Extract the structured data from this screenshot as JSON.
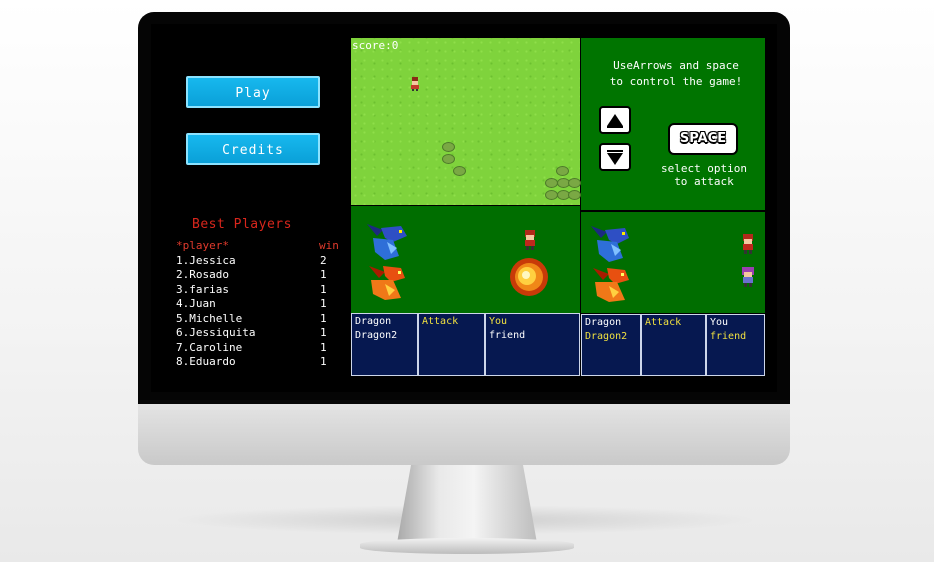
{
  "menu": {
    "play_label": "Play",
    "credits_label": "Credits"
  },
  "leaderboard": {
    "title": "Best Players",
    "header_player": "*player*",
    "header_win": "win",
    "rows": [
      {
        "name": "1.Jessica",
        "win": "2"
      },
      {
        "name": "2.Rosado",
        "win": "1"
      },
      {
        "name": "3.farias",
        "win": "1"
      },
      {
        "name": "4.Juan",
        "win": "1"
      },
      {
        "name": "5.Michelle",
        "win": "1"
      },
      {
        "name": "6.Jessiquita",
        "win": "1"
      },
      {
        "name": "7.Caroline",
        "win": "1"
      },
      {
        "name": "8.Eduardo",
        "win": "1"
      }
    ]
  },
  "game": {
    "score": "score:0",
    "instructions_line1": "UseArrows and space",
    "instructions_line2": "to control the game!",
    "space_key": "SPACE",
    "select_line1": "select option",
    "select_line2": "to attack"
  },
  "battle1": {
    "enemies": [
      "Dragon",
      "Dragon2"
    ],
    "action": "Attack",
    "party": [
      "You",
      "friend"
    ]
  },
  "battle2": {
    "enemies": [
      "Dragon",
      "Dragon2"
    ],
    "action": "Attack",
    "party": [
      "You",
      "friend"
    ]
  },
  "colors": {
    "map_grass": "#7fd33c",
    "panel_green": "#006e00",
    "menu_box": "#061850",
    "button": "#0aa0d8",
    "leaderboard_title": "#d8261c",
    "highlight_text": "#f0e040"
  }
}
